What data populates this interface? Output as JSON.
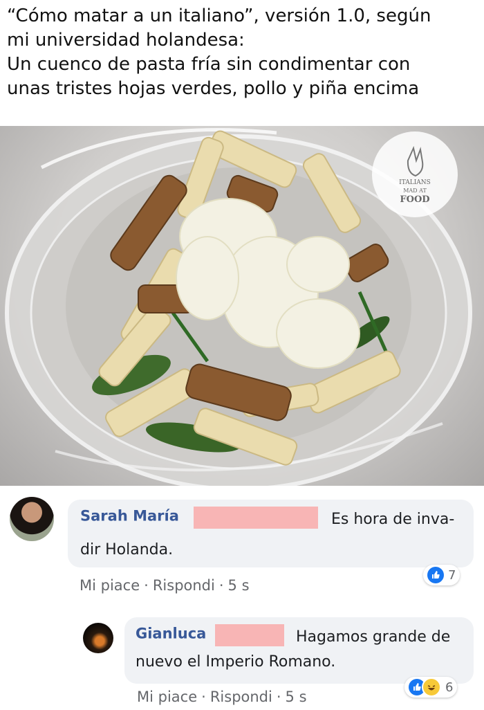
{
  "caption": {
    "lines": [
      "“Cómo matar a un italiano”, versión 1.0, según",
      "mi universidad holandesa:",
      "Un cuenco de pasta fría sin condimentar con",
      "unas tristes hojas verdes, pollo y piña encima"
    ]
  },
  "watermark": {
    "line1": "ITALIANS",
    "line2": "MAD AT",
    "line3": "FOOD"
  },
  "comments": [
    {
      "author": "Sarah María",
      "text_part1": "Es hora de inva-",
      "text_part2": "dir Holanda.",
      "like": "Mi piace",
      "reply": "Rispondi",
      "time": "5 s",
      "reaction_count": "7"
    },
    {
      "author": "Gianluca",
      "text_part1": "Hagamos grande de",
      "text_part2": "nuevo el Imperio Romano.",
      "like": "Mi piace",
      "reply": "Rispondi",
      "time": "5 s",
      "reaction_count": "6"
    }
  ],
  "colors": {
    "name": "#385898",
    "bubble": "#f0f2f5",
    "redaction": "#f8b5b5",
    "like_blue": "#1877f2"
  }
}
